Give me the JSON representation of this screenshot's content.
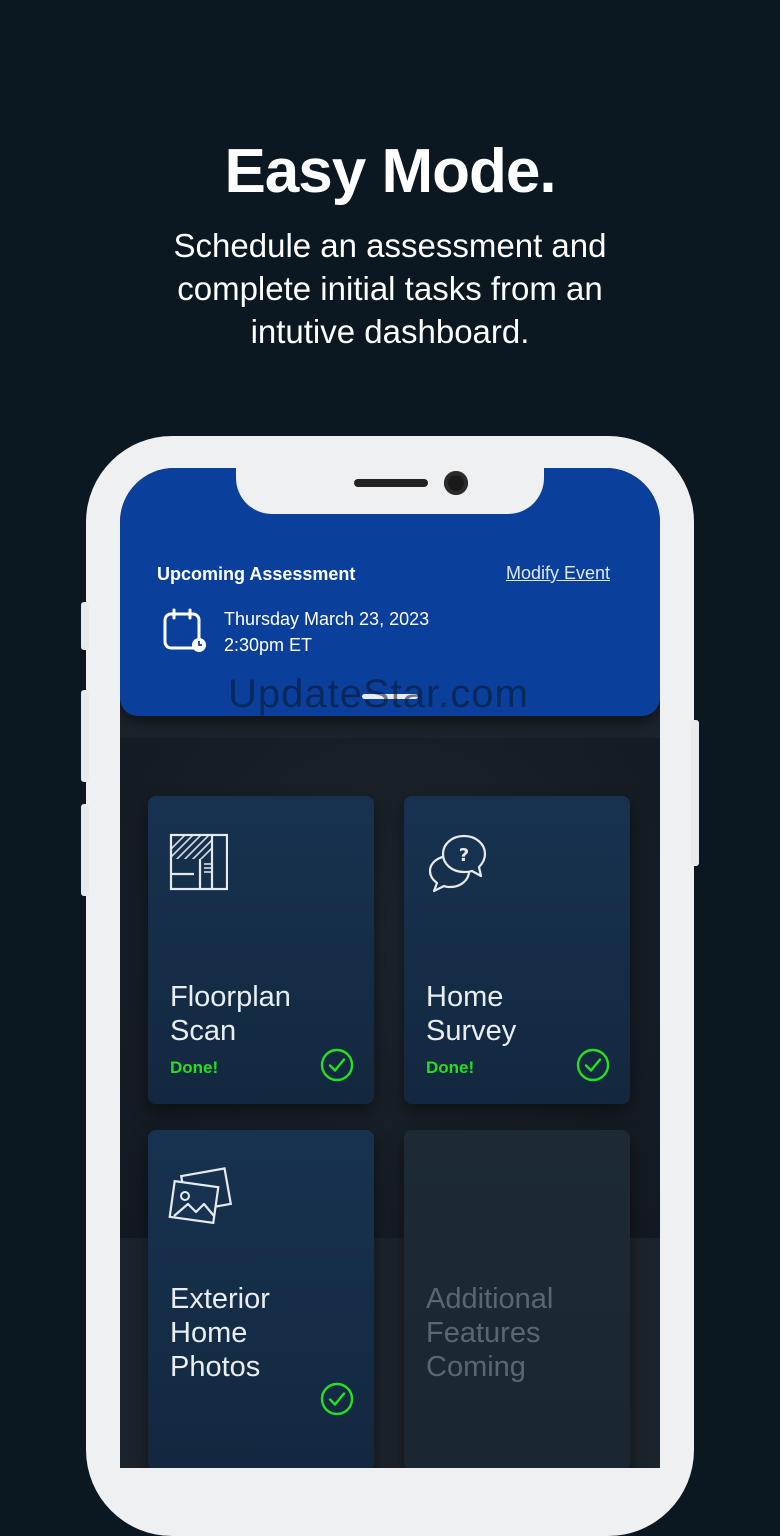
{
  "hero": {
    "title": "Easy Mode.",
    "subtitle": "Schedule an assessment and complete initial tasks from an intutive dashboard."
  },
  "assessment": {
    "title": "Upcoming Assessment",
    "modify_label": "Modify Event",
    "date": "Thursday March 23, 2023",
    "time": "2:30pm ET",
    "icon": "calendar-clock-icon",
    "accent_color": "#0a409c"
  },
  "watermark": "UpdateStar.com",
  "tiles": [
    {
      "title": "Floorplan\nScan",
      "status": "Done!",
      "icon": "floorplan-icon"
    },
    {
      "title": "Home\nSurvey",
      "status": "Done!",
      "icon": "chat-question-icon"
    },
    {
      "title": "Exterior\nHome\nPhotos",
      "status": "",
      "icon": "photos-icon"
    },
    {
      "title": "Additional\nFeatures\nComing",
      "status": "",
      "icon": ""
    }
  ],
  "status_color": "#22e022"
}
